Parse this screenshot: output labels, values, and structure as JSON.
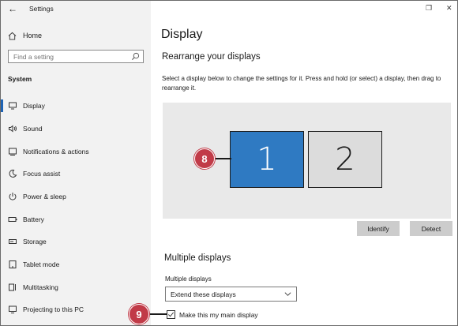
{
  "window": {
    "title": "Settings",
    "back_glyph": "←",
    "restore_glyph": "❐",
    "close_glyph": "✕"
  },
  "sidebar": {
    "home_label": "Home",
    "search_placeholder": "Find a setting",
    "section_label": "System",
    "items": [
      {
        "label": "Display",
        "icon": "monitor-icon",
        "active": true
      },
      {
        "label": "Sound",
        "icon": "speaker-icon"
      },
      {
        "label": "Notifications & actions",
        "icon": "notification-icon"
      },
      {
        "label": "Focus assist",
        "icon": "moon-icon"
      },
      {
        "label": "Power & sleep",
        "icon": "power-icon"
      },
      {
        "label": "Battery",
        "icon": "battery-icon"
      },
      {
        "label": "Storage",
        "icon": "storage-icon"
      },
      {
        "label": "Tablet mode",
        "icon": "tablet-icon"
      },
      {
        "label": "Multitasking",
        "icon": "multitasking-icon"
      },
      {
        "label": "Projecting to this PC",
        "icon": "projector-icon"
      }
    ]
  },
  "main": {
    "title": "Display",
    "rearrange_title": "Rearrange your displays",
    "instructions": "Select a display below to change the settings for it. Press and hold (or select) a display, then drag to rearrange it.",
    "monitors": [
      {
        "label": "1",
        "selected": true
      },
      {
        "label": "2",
        "selected": false
      }
    ],
    "identify_label": "Identify",
    "detect_label": "Detect",
    "multiple_title": "Multiple displays",
    "multiple_field_label": "Multiple displays",
    "multiple_value": "Extend these displays",
    "main_display_label": "Make this my main display",
    "main_display_checked": true
  },
  "callouts": {
    "c8": "8",
    "c9": "9"
  },
  "colors": {
    "accent": "#1e63b4",
    "selected_monitor": "#2f7ac2",
    "callout": "#c13b48"
  }
}
